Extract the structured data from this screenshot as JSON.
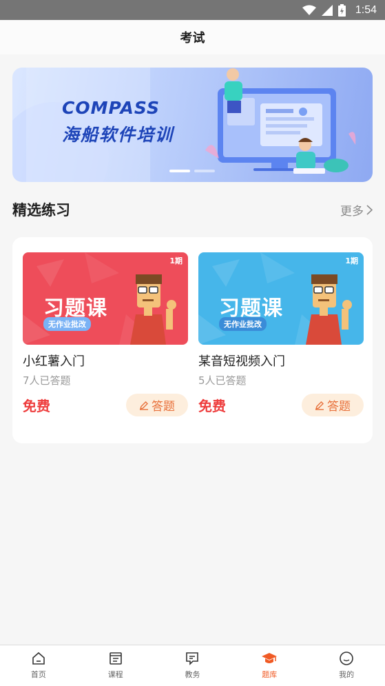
{
  "status_bar": {
    "time": "1:54"
  },
  "header": {
    "title": "考试"
  },
  "banner": {
    "line1": "COMPASS",
    "line2": "海船软件培训"
  },
  "section": {
    "title": "精选练习",
    "more_label": "更多"
  },
  "items": [
    {
      "title": "小红薯入门",
      "count": "7人已答题",
      "price": "免费",
      "button": "答题",
      "thumb_main": "习题课",
      "thumb_tag": "无作业批改",
      "thumb_period": "1期",
      "thumb_color": "#ee4d5a"
    },
    {
      "title": "某音短视频入门",
      "count": "5人已答题",
      "price": "免费",
      "button": "答题",
      "thumb_main": "习题课",
      "thumb_tag": "无作业批改",
      "thumb_period": "1期",
      "thumb_color": "#46b6ea"
    }
  ],
  "nav": [
    {
      "label": "首页",
      "icon": "home-icon"
    },
    {
      "label": "课程",
      "icon": "course-icon"
    },
    {
      "label": "教务",
      "icon": "chat-icon"
    },
    {
      "label": "题库",
      "icon": "graduation-cap-icon",
      "active": true
    },
    {
      "label": "我的",
      "icon": "smile-icon"
    }
  ],
  "colors": {
    "accent": "#f05a24",
    "price": "#ee3d3d",
    "button_bg": "#fdeedd"
  }
}
